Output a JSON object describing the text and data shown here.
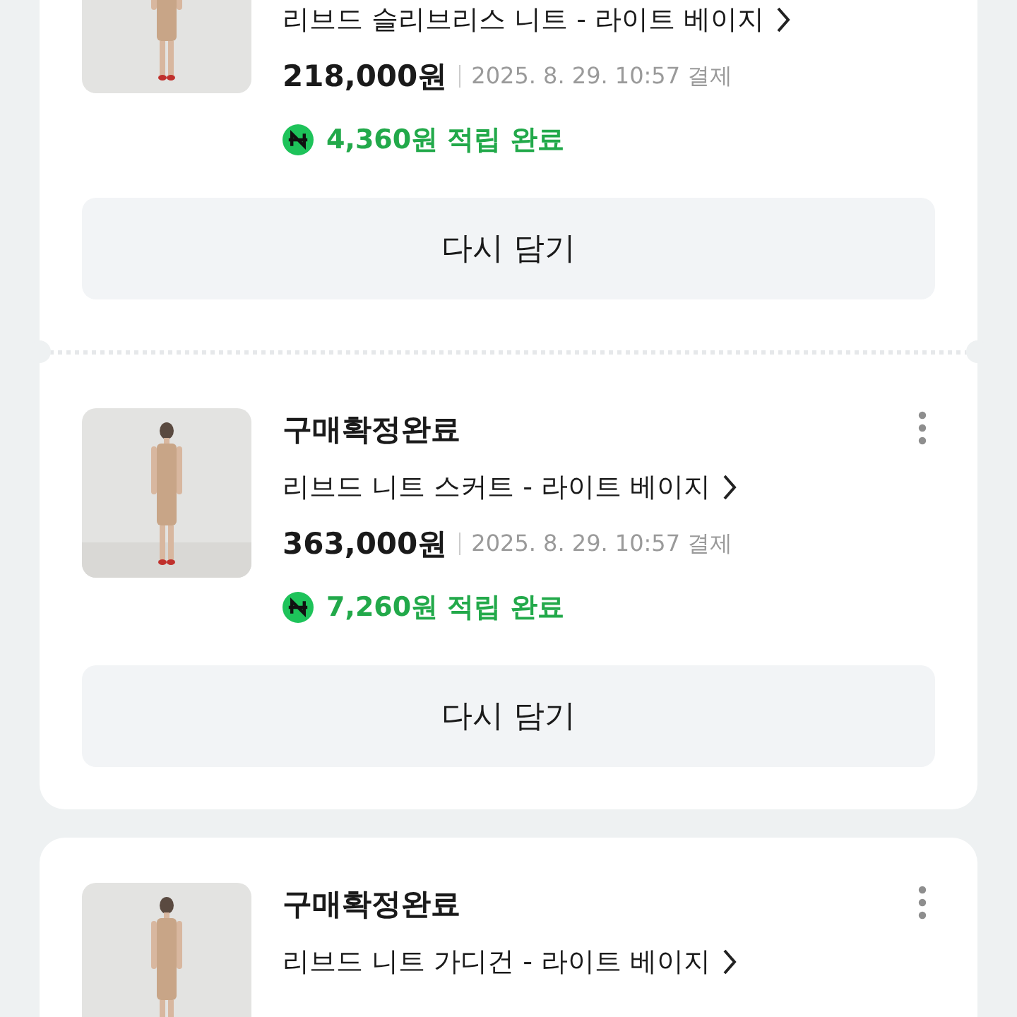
{
  "groups": [
    {
      "items": [
        {
          "product": "리브드 슬리브리스 니트 - 라이트 베이지",
          "price": "218,000원",
          "paid": "2025. 8. 29. 10:57 결제",
          "reward": "4,360원 적립 완료",
          "button": "다시 담기"
        },
        {
          "status": "구매확정완료",
          "product": "리브드 니트 스커트 - 라이트 베이지",
          "price": "363,000원",
          "paid": "2025. 8. 29. 10:57 결제",
          "reward": "7,260원 적립 완료",
          "button": "다시 담기"
        }
      ]
    },
    {
      "items": [
        {
          "status": "구매확정완료",
          "product": "리브드 니트 가디건 - 라이트 베이지"
        }
      ]
    }
  ]
}
